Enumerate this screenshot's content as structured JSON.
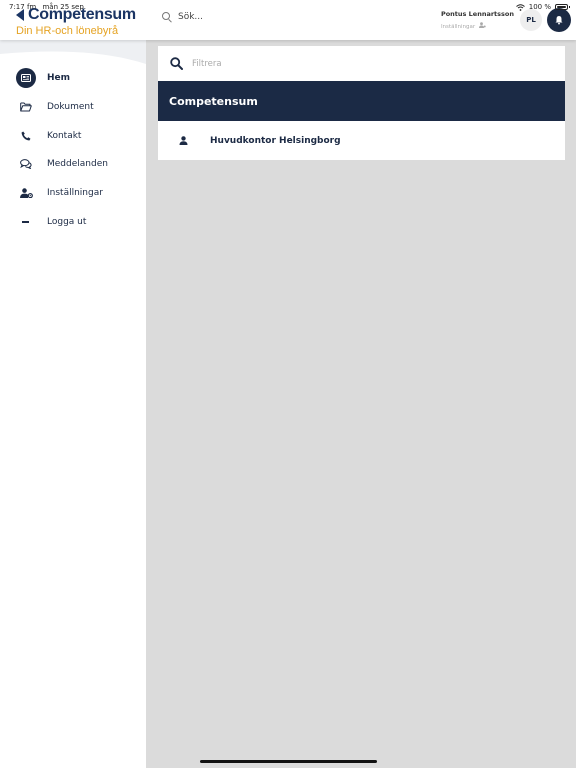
{
  "status_bar": {
    "time": "7:17 fm",
    "date": "mån 25 sep.",
    "battery": "100 %"
  },
  "header": {
    "logo_name": "Competensum",
    "logo_tagline": "Din HR-och lönebyrå",
    "search_label": "Sök...",
    "user_name": "Pontus Lennartsson",
    "user_settings": "Inställningar",
    "avatar_initials": "PL"
  },
  "sidebar": {
    "items": [
      {
        "label": "Hem",
        "icon": "home-card-icon"
      },
      {
        "label": "Dokument",
        "icon": "folder-icon"
      },
      {
        "label": "Kontakt",
        "icon": "phone-icon"
      },
      {
        "label": "Meddelanden",
        "icon": "chat-icon"
      },
      {
        "label": "Inställningar",
        "icon": "user-gear-icon"
      },
      {
        "label": "Logga ut",
        "icon": "minus-icon"
      }
    ]
  },
  "main": {
    "filter_placeholder": "Filtrera",
    "company": "Competensum",
    "offices": [
      {
        "name": "Huvudkontor Helsingborg",
        "icon": "person-icon"
      }
    ]
  },
  "colors": {
    "navy": "#1b2a45",
    "brand_blue": "#1b3564",
    "brand_orange": "#e5a323",
    "content_bg": "#dbdbdb"
  }
}
